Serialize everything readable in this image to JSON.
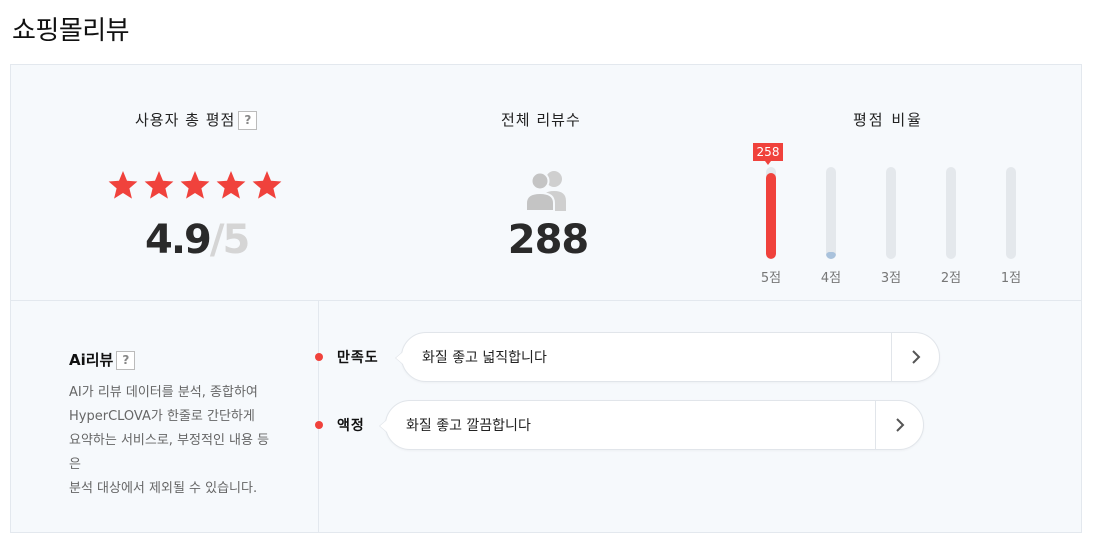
{
  "page_title": "쇼핑몰리뷰",
  "summary": {
    "rating": {
      "title": "사용자 총 평점",
      "help_icon": "?",
      "score": "4.9",
      "separator": "/",
      "max": "5",
      "stars_filled": 5,
      "star_color": "#f0423c"
    },
    "reviews": {
      "title": "전체 리뷰수",
      "icon": "people-icon",
      "count": "288"
    },
    "ratio": {
      "title": "평점 비율",
      "top_badge": "258",
      "bars": [
        {
          "label": "5점",
          "fraction": 0.94,
          "color": "#f0423c"
        },
        {
          "label": "4점",
          "fraction": 0.08,
          "color": "#a9c2dc"
        },
        {
          "label": "3점",
          "fraction": 0.0,
          "color": "#a9c2dc"
        },
        {
          "label": "2점",
          "fraction": 0.0,
          "color": "#a9c2dc"
        },
        {
          "label": "1점",
          "fraction": 0.0,
          "color": "#a9c2dc"
        }
      ]
    }
  },
  "ai_review": {
    "title": "Ai리뷰",
    "help_icon": "?",
    "description_lines": [
      "AI가 리뷰 데이터를 분석, 종합하여",
      "HyperCLOVA가 한줄로 간단하게",
      "요약하는 서비스로, 부정적인 내용 등",
      "은",
      "분석 대상에서 제외될 수 있습니다."
    ],
    "items": [
      {
        "aspect": "만족도",
        "summary": "화질 좋고 넓직합니다"
      },
      {
        "aspect": "액정",
        "summary": "화질 좋고 깔끔합니다"
      }
    ]
  }
}
